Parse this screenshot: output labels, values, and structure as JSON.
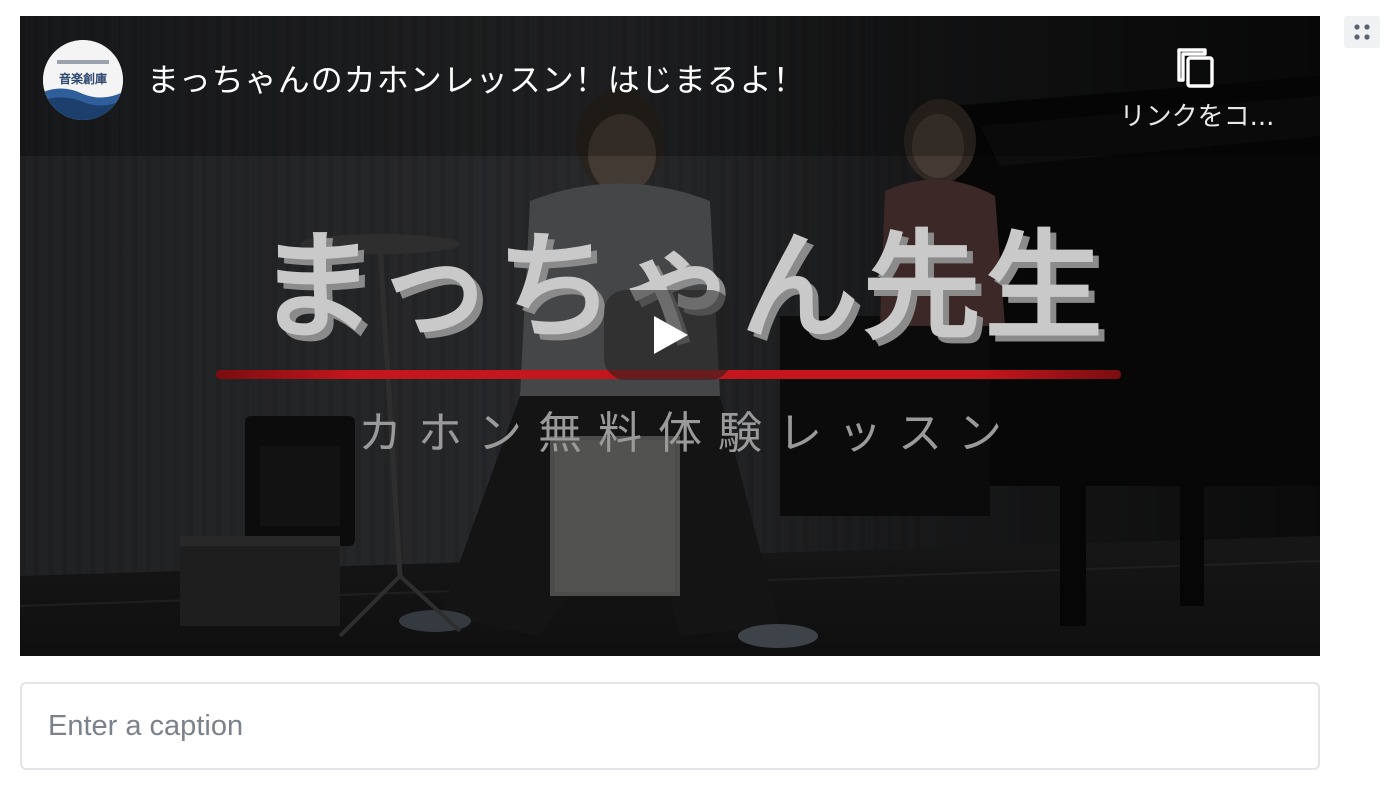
{
  "video": {
    "title": "まっちゃんのカホンレッスン！はじまるよ！",
    "channel_logo_text": "音楽創庫",
    "overlay_title": "まっちゃん先生",
    "overlay_subtitle": "カホン無料体験レッスン",
    "copy_link_label": "リンクをコ...",
    "play_icon": "play-icon",
    "copy_icon": "copy-icon"
  },
  "caption": {
    "placeholder": "Enter a caption",
    "value": ""
  },
  "drag_handle_icon": "drag-handle-icon",
  "colors": {
    "accent_red": "#c4161c",
    "caption_border": "#e2e4e8",
    "placeholder_text": "#7c828c",
    "handle_background": "#f0f1f3"
  }
}
